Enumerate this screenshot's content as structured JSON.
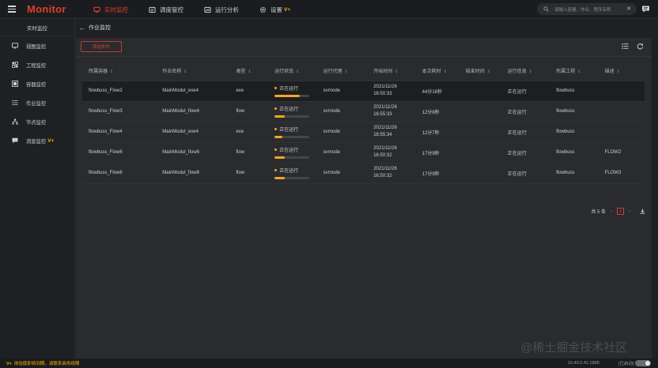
{
  "header": {
    "brand": "Monitor",
    "nav": [
      {
        "label": "实时监控",
        "icon": "monitor-icon",
        "active": true
      },
      {
        "label": "调度管控",
        "icon": "schedule-icon",
        "active": false
      },
      {
        "label": "运行分析",
        "icon": "analysis-icon",
        "active": false
      },
      {
        "label": "设置",
        "icon": "gear-icon",
        "active": false,
        "badge": "V+"
      }
    ],
    "search_placeholder": "请输入容器、作业、程序名称"
  },
  "sidebar": {
    "title": "实时监控",
    "items": [
      {
        "label": "视图监控",
        "icon": "view-icon"
      },
      {
        "label": "工程监控",
        "icon": "project-icon"
      },
      {
        "label": "容器监控",
        "icon": "container-icon"
      },
      {
        "label": "作业监控",
        "icon": "job-icon"
      },
      {
        "label": "节点监控",
        "icon": "node-icon"
      },
      {
        "label": "消息监控",
        "icon": "message-icon",
        "badge": "V+"
      }
    ]
  },
  "main": {
    "breadcrumb": "作业监控",
    "filter_label": "筛选条件",
    "columns": [
      "所属容器",
      "作业名称",
      "类型",
      "运行状态",
      "运行代理",
      "开始时间",
      "本次耗时",
      "结束时间",
      "运行信息",
      "所属工程",
      "描述"
    ],
    "rows": [
      {
        "container": "flowbuss_Flow2",
        "job": "MainModul_exe4",
        "type": "exe",
        "status": "正在运行",
        "progress": 0.72,
        "agent": "svrnode",
        "start_date": "2021/11/26",
        "start_time": "16:50:33",
        "elapsed": "44分16秒",
        "end": "",
        "info": "正在运行",
        "project": "flowbuss",
        "desc": ""
      },
      {
        "container": "flowbuss_Flow3",
        "job": "MainModul_flow4",
        "type": "flow",
        "status": "正在运行",
        "progress": 0.3,
        "agent": "svrnode",
        "start_date": "2021/11/26",
        "start_time": "16:55:33",
        "elapsed": "12分8秒",
        "end": "",
        "info": "正在运行",
        "project": "flowbuss",
        "desc": ""
      },
      {
        "container": "flowbuss_Flow4",
        "job": "MainModul_exe4",
        "type": "exe",
        "status": "正在运行",
        "progress": 0.22,
        "agent": "svrnode",
        "start_date": "2021/11/26",
        "start_time": "16:55:34",
        "elapsed": "12分7秒",
        "end": "",
        "info": "正在运行",
        "project": "flowbuss",
        "desc": ""
      },
      {
        "container": "flowbuss_Flow6",
        "job": "MainModul_flow6",
        "type": "flow",
        "status": "正在运行",
        "progress": 0.28,
        "agent": "svrnode",
        "start_date": "2021/11/26",
        "start_time": "16:50:32",
        "elapsed": "17分9秒",
        "end": "",
        "info": "正在运行",
        "project": "flowbuss",
        "desc": "FLOW2"
      },
      {
        "container": "flowbuss_Flow6",
        "job": "MainModul_flow8",
        "type": "flow",
        "status": "正在运行",
        "progress": 0.28,
        "agent": "svrnode",
        "start_date": "2021/11/26",
        "start_time": "16:50:32",
        "elapsed": "17分9秒",
        "end": "",
        "info": "正在运行",
        "project": "flowbuss",
        "desc": "FLOW3"
      }
    ],
    "pager": {
      "total": "共 5 条",
      "page": "1"
    }
  },
  "footer": {
    "badge": "V+",
    "notice": "体验版即将到期，请联系商务续期",
    "ip": "10.40.0.41:1888",
    "connection": "已启动"
  },
  "watermark": "@稀土掘金技术社区"
}
